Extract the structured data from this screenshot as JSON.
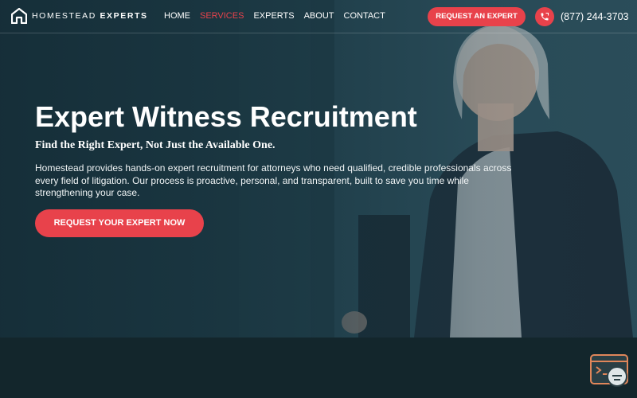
{
  "header": {
    "logo": {
      "light": "HOMESTEAD ",
      "bold": "EXPERTS",
      "icon": "house-logo-icon"
    },
    "nav": [
      {
        "label": "HOME",
        "active": false
      },
      {
        "label": "SERVICES",
        "active": true
      },
      {
        "label": "EXPERTS",
        "active": false
      },
      {
        "label": "ABOUT",
        "active": false
      },
      {
        "label": "CONTACT",
        "active": false
      }
    ],
    "cta_label": "REQUEST AN EXPERT",
    "phone": {
      "icon": "phone-icon",
      "number": "(877) 244-3703"
    }
  },
  "hero": {
    "title": "Expert Witness Recruitment",
    "subtitle": "Find the Right Expert, Not Just the Available One.",
    "body": "Homestead provides hands-on expert recruitment for attorneys who need qualified, credible professionals across every field of litigation. Our process is proactive, personal, and transparent, built to save you time while strengthening your case.",
    "cta_label": "REQUEST YOUR EXPERT NOW"
  },
  "widget": {
    "icon": "chat-widget-icon"
  },
  "colors": {
    "accent": "#e8424b",
    "background": "#13262c",
    "hero_tint": "#1f3d48"
  }
}
